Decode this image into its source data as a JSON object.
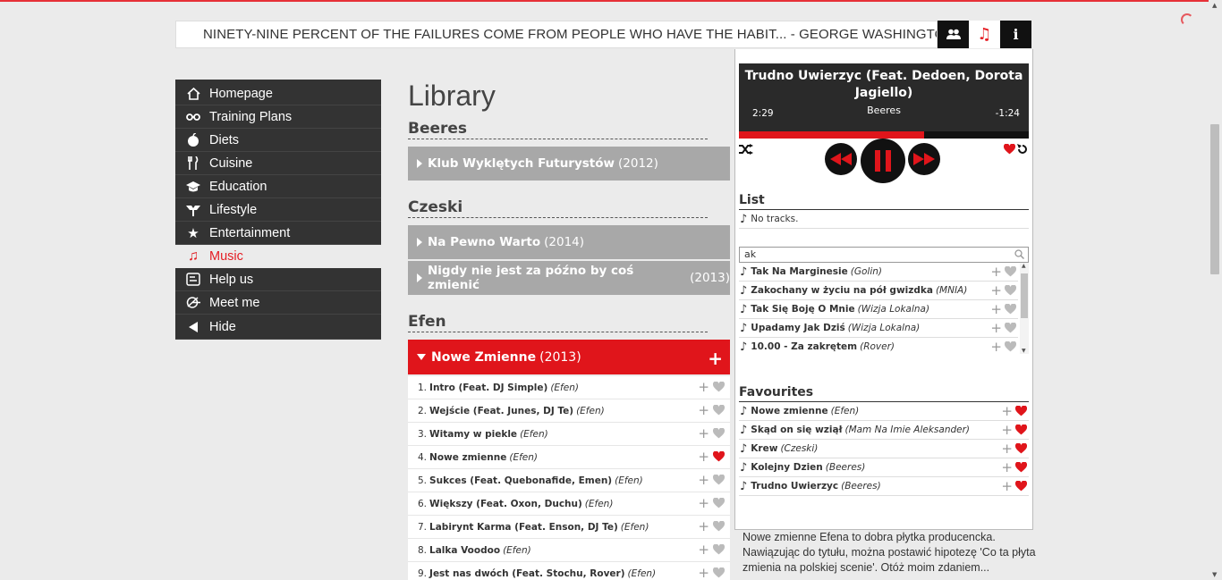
{
  "quote": {
    "text": "NINETY-NINE PERCENT OF THE FAILURES COME FROM PEOPLE WHO HAVE THE HABIT... -  GEORGE WASHINGTON CARVER"
  },
  "menu": [
    {
      "label": "Homepage",
      "icon": "home-icon"
    },
    {
      "label": "Training Plans",
      "icon": "dumbbell-icon"
    },
    {
      "label": "Diets",
      "icon": "apple-icon"
    },
    {
      "label": "Cuisine",
      "icon": "cutlery-icon"
    },
    {
      "label": "Education",
      "icon": "graduation-cap-icon"
    },
    {
      "label": "Lifestyle",
      "icon": "lifestyle-icon"
    },
    {
      "label": "Entertainment",
      "icon": "star-icon"
    },
    {
      "label": "Music",
      "icon": "music-note-icon",
      "active": true
    },
    {
      "label": "Help us",
      "icon": "help-icon"
    },
    {
      "label": "Meet me",
      "icon": "meet-icon"
    },
    {
      "label": "Hide",
      "icon": "triangle-left-icon"
    }
  ],
  "library": {
    "title": "Library",
    "artists": [
      {
        "name": "Beeres",
        "albums": [
          {
            "title": "Klub Wyklętych Futurystów",
            "year": "(2012)"
          }
        ]
      },
      {
        "name": "Czeski",
        "albums": [
          {
            "title": "Na Pewno Warto",
            "year": "(2014)"
          },
          {
            "title": "Nigdy nie jest za późno by coś zmienić",
            "year": "(2013)"
          }
        ]
      },
      {
        "name": "Efen",
        "albums": [
          {
            "title": "Nowe Zmienne",
            "year": "(2013)",
            "open": true
          }
        ]
      }
    ],
    "tracks": [
      {
        "num": "1.",
        "title": "Intro (Feat. DJ Simple)",
        "artist": "(Efen)",
        "fav": false
      },
      {
        "num": "2.",
        "title": "Wejście (Feat. Junes, DJ Te)",
        "artist": "(Efen)",
        "fav": false
      },
      {
        "num": "3.",
        "title": "Witamy w piekle",
        "artist": "(Efen)",
        "fav": false
      },
      {
        "num": "4.",
        "title": "Nowe zmienne",
        "artist": "(Efen)",
        "fav": true
      },
      {
        "num": "5.",
        "title": "Sukces (Feat. Quebonafide, Emen)",
        "artist": "(Efen)",
        "fav": false
      },
      {
        "num": "6.",
        "title": "Większy (Feat. Oxon, Duchu)",
        "artist": "(Efen)",
        "fav": false
      },
      {
        "num": "7.",
        "title": "Labirynt Karma (Feat. Enson, DJ Te)",
        "artist": "(Efen)",
        "fav": false
      },
      {
        "num": "8.",
        "title": "Lalka Voodoo",
        "artist": "(Efen)",
        "fav": false
      },
      {
        "num": "9.",
        "title": "Jest nas dwóch (Feat. Stochu, Rover)",
        "artist": "(Efen)",
        "fav": false
      }
    ]
  },
  "player": {
    "title": "Trudno Uwierzyc (Feat. Dedoen, Dorota Jagiello)",
    "artist": "Beeres",
    "elapsed": "2:29",
    "remaining": "-1:24",
    "progress": 0.64,
    "list_heading": "List",
    "list_empty": "No tracks.",
    "search_value": "ak",
    "results": [
      {
        "title": "Tak Na Marginesie",
        "artist": "(Golin)"
      },
      {
        "title": "Zakochany w życiu na pół gwizdka",
        "artist": "(MNIA)"
      },
      {
        "title": "Tak Się Boję O Mnie",
        "artist": "(Wizja Lokalna)"
      },
      {
        "title": "Upadamy Jak Dziś",
        "artist": "(Wizja Lokalna)"
      },
      {
        "title": "10.00 - Za zakrętem",
        "artist": "(Rover)"
      }
    ],
    "fav_heading": "Favourites",
    "favourites": [
      {
        "title": "Nowe zmienne",
        "artist": "(Efen)"
      },
      {
        "title": "Skąd on się wziął",
        "artist": "(Mam Na Imie Aleksander)"
      },
      {
        "title": "Krew",
        "artist": "(Czeski)"
      },
      {
        "title": "Kolejny Dzien",
        "artist": "(Beeres)"
      },
      {
        "title": "Trudno Uwierzyc",
        "artist": "(Beeres)"
      }
    ]
  },
  "description": "Nowe zmienne Efena to dobra płytka producencka. Nawiązując do tytułu, można postawić hipotezę 'Co ta płyta zmienia na polskiej scenie'. Otóż moim zdaniem...",
  "colors": {
    "accent": "#e0151b",
    "dark": "#333333"
  }
}
